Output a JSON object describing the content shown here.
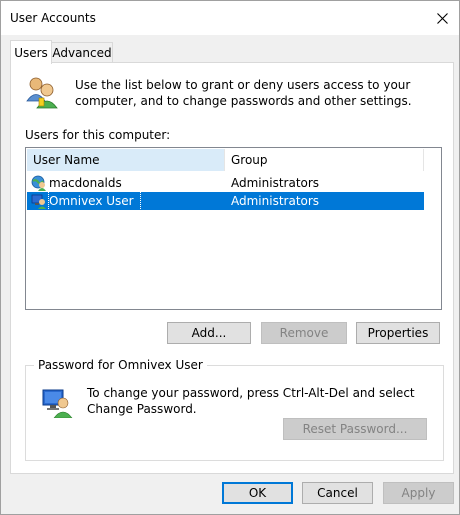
{
  "window": {
    "title": "User Accounts"
  },
  "tabs": [
    {
      "label": "Users",
      "active": true
    },
    {
      "label": "Advanced",
      "active": false
    }
  ],
  "intro_text": "Use the list below to grant or deny users access to your computer, and to change passwords and other settings.",
  "users_label": "Users for this computer:",
  "table": {
    "columns": [
      "User Name",
      "Group"
    ],
    "rows": [
      {
        "name": "macdonalds",
        "group": "Administrators",
        "selected": false
      },
      {
        "name": "Omnivex User",
        "group": "Administrators",
        "selected": true
      }
    ]
  },
  "buttons": {
    "add": "Add...",
    "remove": "Remove",
    "properties": "Properties"
  },
  "password_group": {
    "title": "Password for Omnivex User",
    "text": "To change your password, press Ctrl-Alt-Del and select Change Password.",
    "reset": "Reset Password..."
  },
  "footer": {
    "ok": "OK",
    "cancel": "Cancel",
    "apply": "Apply"
  },
  "colors": {
    "selection": "#0078d7",
    "column_highlight": "#d9ebf9"
  }
}
